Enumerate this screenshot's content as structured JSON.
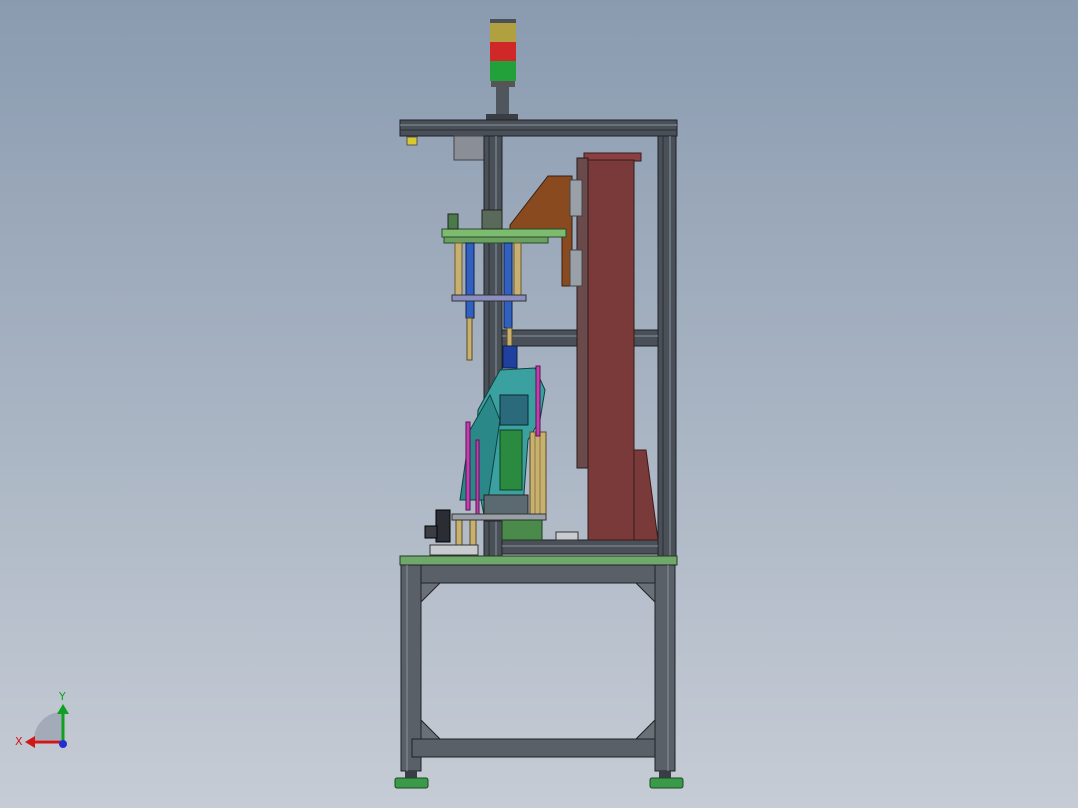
{
  "viewport": {
    "background_top": "#8a9bb0",
    "background_bottom": "#c6ccd5"
  },
  "triad": {
    "x_label": "X",
    "y_label": "Y",
    "x_color": "#d01818",
    "y_color": "#10a020",
    "z_color": "#2030d0"
  },
  "colors": {
    "frame": "#4a5058",
    "frame_dark": "#2a2e34",
    "table_top": "#6fa86a",
    "plate_green": "#7dbb6e",
    "panel_maroon": "#7a3a3a",
    "bracket_brown": "#8a4a20",
    "teal_part": "#3aa0a0",
    "cylinder_blue": "#3060c0",
    "magenta_rod": "#c040b0",
    "tan_guide": "#c8b070",
    "lamp_green": "#22a03a",
    "lamp_red": "#d02828",
    "lamp_yellow": "#b0a040",
    "foot_green": "#3a9a4a"
  }
}
